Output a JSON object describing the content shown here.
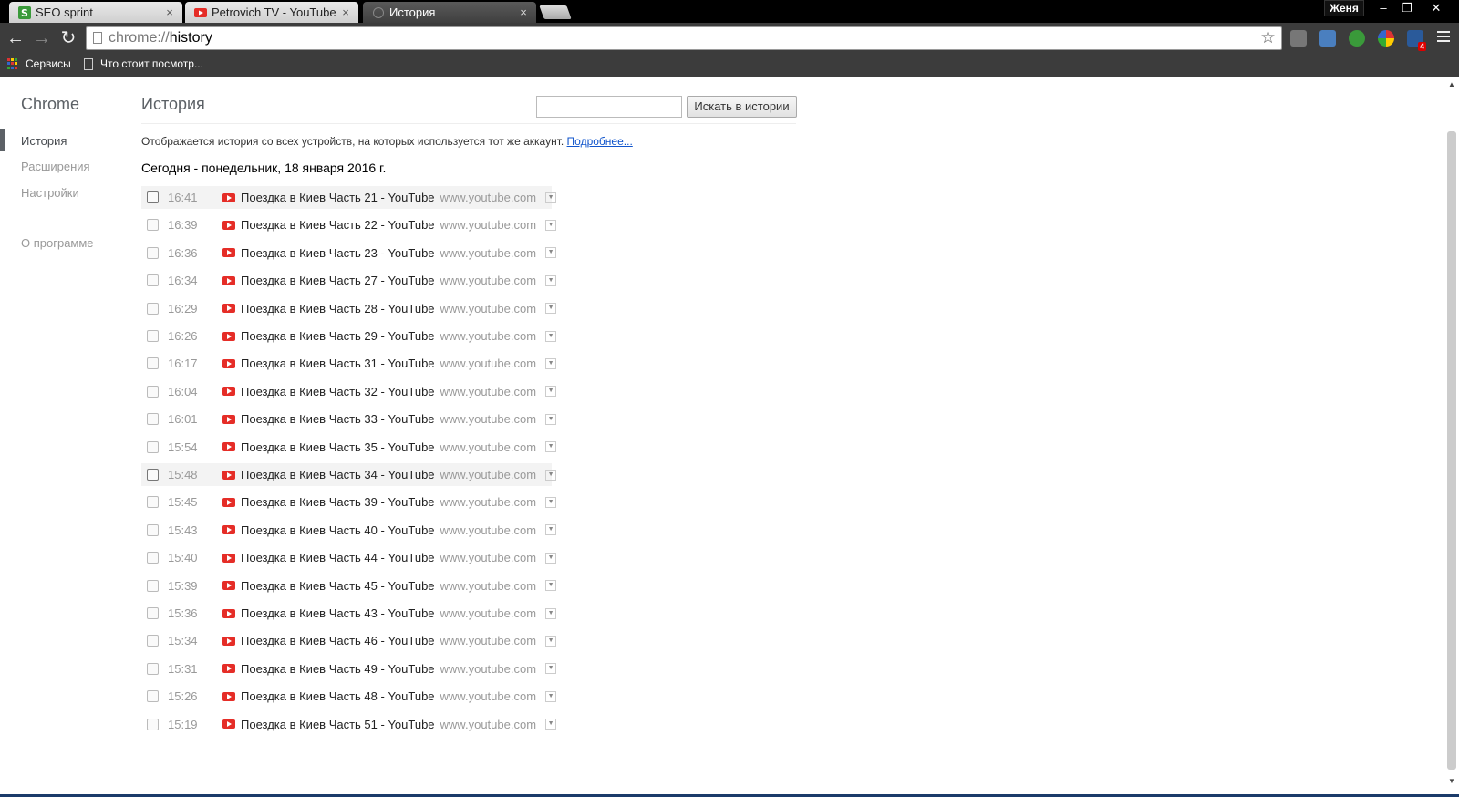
{
  "tabs": [
    {
      "title": "SEO sprint",
      "close": "×"
    },
    {
      "title": "Petrovich TV - YouTube",
      "close": "×"
    },
    {
      "title": "История",
      "close": "×"
    }
  ],
  "window": {
    "user": "Женя",
    "minimize": "–",
    "restore": "❐",
    "close": "✕"
  },
  "toolbar": {
    "back": "←",
    "forward": "→",
    "reload": "↻",
    "url_scheme": "chrome://",
    "url_path": "history",
    "star": "☆"
  },
  "extensions": {
    "notification_count": "4"
  },
  "bookmarks": [
    {
      "label": "Сервисы"
    },
    {
      "label": "Что стоит посмотр..."
    }
  ],
  "sidebar": {
    "title": "Chrome",
    "items": [
      {
        "label": "История"
      },
      {
        "label": "Расширения"
      },
      {
        "label": "Настройки"
      },
      {
        "label": "О программе"
      }
    ]
  },
  "history": {
    "title": "История",
    "search_placeholder": "",
    "search_button": "Искать в истории",
    "info": "Отображается история со всех устройств, на которых используется тот же аккаунт.",
    "learn_more": "Подробнее...",
    "day": "Сегодня - понедельник, 18 января 2016 г.",
    "entries": [
      {
        "time": "16:41",
        "title": "Поездка в Киев Часть 21 - YouTube",
        "domain": "www.youtube.com"
      },
      {
        "time": "16:39",
        "title": "Поездка в Киев Часть 22 - YouTube",
        "domain": "www.youtube.com"
      },
      {
        "time": "16:36",
        "title": "Поездка в Киев Часть 23 - YouTube",
        "domain": "www.youtube.com"
      },
      {
        "time": "16:34",
        "title": "Поездка в Киев Часть 27 - YouTube",
        "domain": "www.youtube.com"
      },
      {
        "time": "16:29",
        "title": "Поездка в Киев Часть 28 - YouTube",
        "domain": "www.youtube.com"
      },
      {
        "time": "16:26",
        "title": "Поездка в Киев Часть 29 - YouTube",
        "domain": "www.youtube.com"
      },
      {
        "time": "16:17",
        "title": "Поездка в Киев Часть 31 - YouTube",
        "domain": "www.youtube.com"
      },
      {
        "time": "16:04",
        "title": "Поездка в Киев Часть 32 - YouTube",
        "domain": "www.youtube.com"
      },
      {
        "time": "16:01",
        "title": "Поездка в Киев Часть 33 - YouTube",
        "domain": "www.youtube.com"
      },
      {
        "time": "15:54",
        "title": "Поездка в Киев Часть 35 - YouTube",
        "domain": "www.youtube.com"
      },
      {
        "time": "15:48",
        "title": "Поездка в Киев Часть 34 - YouTube",
        "domain": "www.youtube.com"
      },
      {
        "time": "15:45",
        "title": "Поездка в Киев Часть 39 - YouTube",
        "domain": "www.youtube.com"
      },
      {
        "time": "15:43",
        "title": "Поездка в Киев Часть 40 - YouTube",
        "domain": "www.youtube.com"
      },
      {
        "time": "15:40",
        "title": "Поездка в Киев Часть 44 - YouTube",
        "domain": "www.youtube.com"
      },
      {
        "time": "15:39",
        "title": "Поездка в Киев Часть 45 - YouTube",
        "domain": "www.youtube.com"
      },
      {
        "time": "15:36",
        "title": "Поездка в Киев Часть 43 - YouTube",
        "domain": "www.youtube.com"
      },
      {
        "time": "15:34",
        "title": "Поездка в Киев Часть 46 - YouTube",
        "domain": "www.youtube.com"
      },
      {
        "time": "15:31",
        "title": "Поездка в Киев Часть 49 - YouTube",
        "domain": "www.youtube.com"
      },
      {
        "time": "15:26",
        "title": "Поездка в Киев Часть 48 - YouTube",
        "domain": "www.youtube.com"
      },
      {
        "time": "15:19",
        "title": "Поездка в Киев Часть 51 - YouTube",
        "domain": "www.youtube.com"
      }
    ]
  },
  "colors": {
    "youtube_red": "#e52d27",
    "link_blue": "#1155cc",
    "chrome_dark": "#3c3c3c"
  }
}
